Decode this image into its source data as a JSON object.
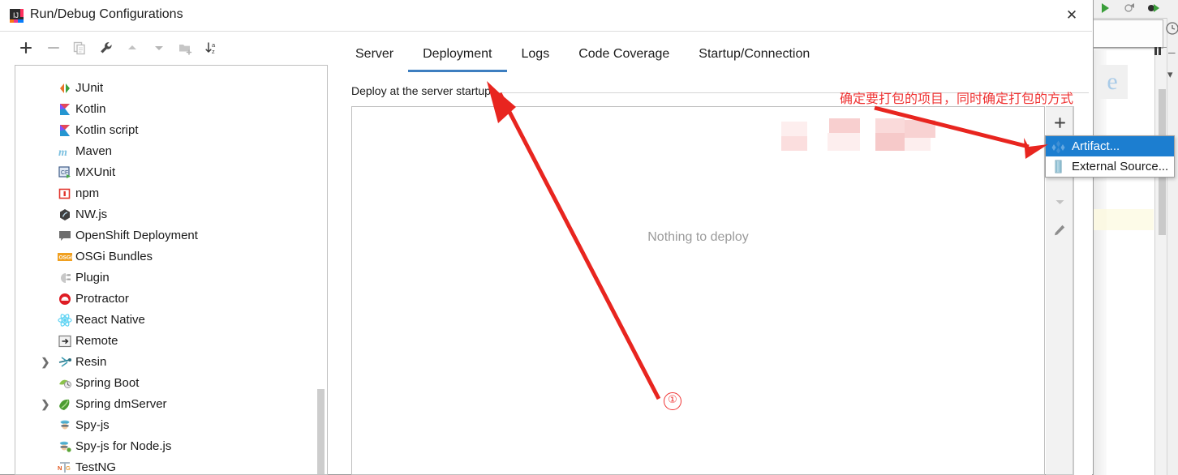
{
  "window": {
    "title": "Run/Debug Configurations",
    "icon": "intellij-idea-icon",
    "close_label": "✕"
  },
  "toolbar": {
    "buttons": [
      {
        "name": "add-configuration-button",
        "glyph": "+",
        "tooltip": "Add New Configuration",
        "enabled": true
      },
      {
        "name": "remove-configuration-button",
        "glyph": "−",
        "tooltip": "Remove Configuration",
        "enabled": false
      },
      {
        "name": "copy-configuration-button",
        "glyph": "copy-icon",
        "tooltip": "Copy Configuration",
        "enabled": false
      },
      {
        "name": "edit-templates-button",
        "glyph": "wrench-icon",
        "tooltip": "Edit Templates",
        "enabled": true
      },
      {
        "name": "move-up-button",
        "glyph": "▲",
        "tooltip": "Move Up",
        "enabled": false
      },
      {
        "name": "move-down-button",
        "glyph": "▼",
        "tooltip": "Move Down",
        "enabled": false
      },
      {
        "name": "create-folder-button",
        "glyph": "folder-plus-icon",
        "tooltip": "Create New Folder",
        "enabled": false
      },
      {
        "name": "sort-configurations-button",
        "glyph": "sort-az-icon",
        "tooltip": "Sort Configurations",
        "enabled": true
      }
    ]
  },
  "tree": {
    "items": [
      {
        "label": "",
        "icon": "partial-cut-item",
        "expandable": false,
        "partial": true
      },
      {
        "label": "JUnit",
        "icon": "junit-icon",
        "expandable": false
      },
      {
        "label": "Kotlin",
        "icon": "kotlin-icon",
        "expandable": false
      },
      {
        "label": "Kotlin script",
        "icon": "kotlin-icon",
        "expandable": false
      },
      {
        "label": "Maven",
        "icon": "maven-icon",
        "expandable": false
      },
      {
        "label": "MXUnit",
        "icon": "mxunit-icon",
        "expandable": false
      },
      {
        "label": "npm",
        "icon": "npm-icon",
        "expandable": false
      },
      {
        "label": "NW.js",
        "icon": "nwjs-icon",
        "expandable": false
      },
      {
        "label": "OpenShift Deployment",
        "icon": "openshift-icon",
        "expandable": false
      },
      {
        "label": "OSGi Bundles",
        "icon": "osgi-icon",
        "expandable": false
      },
      {
        "label": "Plugin",
        "icon": "plugin-icon",
        "expandable": false
      },
      {
        "label": "Protractor",
        "icon": "protractor-icon",
        "expandable": false
      },
      {
        "label": "React Native",
        "icon": "react-native-icon",
        "expandable": false
      },
      {
        "label": "Remote",
        "icon": "remote-icon",
        "expandable": false
      },
      {
        "label": "Resin",
        "icon": "resin-icon",
        "expandable": true
      },
      {
        "label": "Spring Boot",
        "icon": "spring-boot-icon",
        "expandable": false
      },
      {
        "label": "Spring dmServer",
        "icon": "spring-dmserver-icon",
        "expandable": true
      },
      {
        "label": "Spy-js",
        "icon": "spy-js-icon",
        "expandable": false
      },
      {
        "label": "Spy-js for Node.js",
        "icon": "spy-js-node-icon",
        "expandable": false
      },
      {
        "label": "TestNG",
        "icon": "testng-icon",
        "expandable": false
      }
    ]
  },
  "tabs": {
    "items": [
      {
        "label": "Server",
        "active": false
      },
      {
        "label": "Deployment",
        "active": true
      },
      {
        "label": "Logs",
        "active": false
      },
      {
        "label": "Code Coverage",
        "active": false
      },
      {
        "label": "Startup/Connection",
        "active": false
      }
    ]
  },
  "deployment": {
    "section_label": "Deploy at the server startup",
    "empty_message": "Nothing to deploy",
    "side_buttons": [
      {
        "name": "add-artifact-button",
        "glyph": "+"
      },
      {
        "name": "move-up-artifact-button",
        "glyph": "▲"
      },
      {
        "name": "move-down-artifact-button",
        "glyph": "▼"
      },
      {
        "name": "edit-artifact-button",
        "glyph": "pencil-icon"
      }
    ]
  },
  "context_menu": {
    "items": [
      {
        "label": "Artifact...",
        "icon": "artifact-icon",
        "selected": true
      },
      {
        "label": "External Source...",
        "icon": "external-source-icon",
        "selected": false
      }
    ]
  },
  "annotations": {
    "note_text": "确定要打包的项目，同时确定打包的方式",
    "step_marker": "①",
    "color": "#ef3333"
  },
  "colors": {
    "accent_tab": "#3d7ec0",
    "menu_selection": "#1c7ed0",
    "annotation_red": "#ef3333",
    "placeholder_gray": "#9b9b9b"
  }
}
